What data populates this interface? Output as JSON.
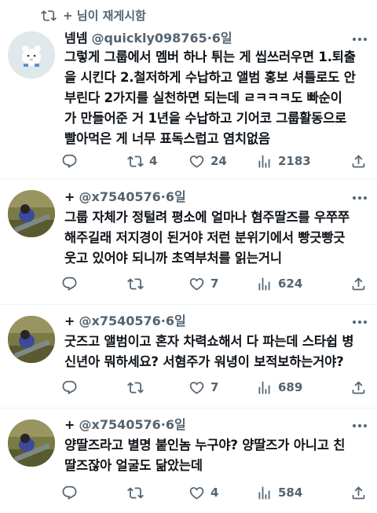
{
  "repost_banner": {
    "text": "+ 님이 재게시함"
  },
  "tweets": [
    {
      "display_name": "넴넴",
      "handle": "@quickly098765",
      "separator": "·",
      "time": "6일",
      "lines": [
        "그렇게 그룹에서 멤버 하나 튀는 게 씹쓰러우면 1.퇴출",
        "을 시킨다 2.철저하게 수납하고 앨범 홍보 셔틀로도 안",
        "부린다 2가지를 실천하면 되는데 ㄹㅋㅋㅋ도 빠순이",
        "가 만들어준 거 1년을 수납하고 기어코 그룹활동으로",
        "빨아먹은 게 너무 표독스럽고 염치없음"
      ],
      "replies": "",
      "reposts": "4",
      "likes": "24",
      "views": "2183"
    },
    {
      "display_name": "+",
      "handle": "@x7540576",
      "separator": "·",
      "time": "6일",
      "lines": [
        "그룹 자체가 정털려 평소에 얼마나 혐주딸즈를 우쭈쭈",
        "해주길래 저지경이 된거야 저런 분위기에서 빵긋빵긋",
        "웃고 있어야 되니까 초역부처를 읽는거니"
      ],
      "replies": "",
      "reposts": "",
      "likes": "7",
      "views": "624"
    },
    {
      "display_name": "+",
      "handle": "@x7540576",
      "separator": "·",
      "time": "6일",
      "lines": [
        "굿즈고 앨범이고 혼자 차력쇼해서 다 파는데 스타쉽 병",
        "신년아 뭐하세요? 서혐주가 워녕이 보적보하는거야?"
      ],
      "replies": "",
      "reposts": "",
      "likes": "7",
      "views": "689"
    },
    {
      "display_name": "+",
      "handle": "@x7540576",
      "separator": "·",
      "time": "6일",
      "lines": [
        "양딸즈라고 별명 붙인놈 누구야? 양딸즈가 아니고 친",
        "딸즈잖아 얼굴도 닮았는데"
      ],
      "replies": "",
      "reposts": "",
      "likes": "4",
      "views": "584"
    }
  ]
}
